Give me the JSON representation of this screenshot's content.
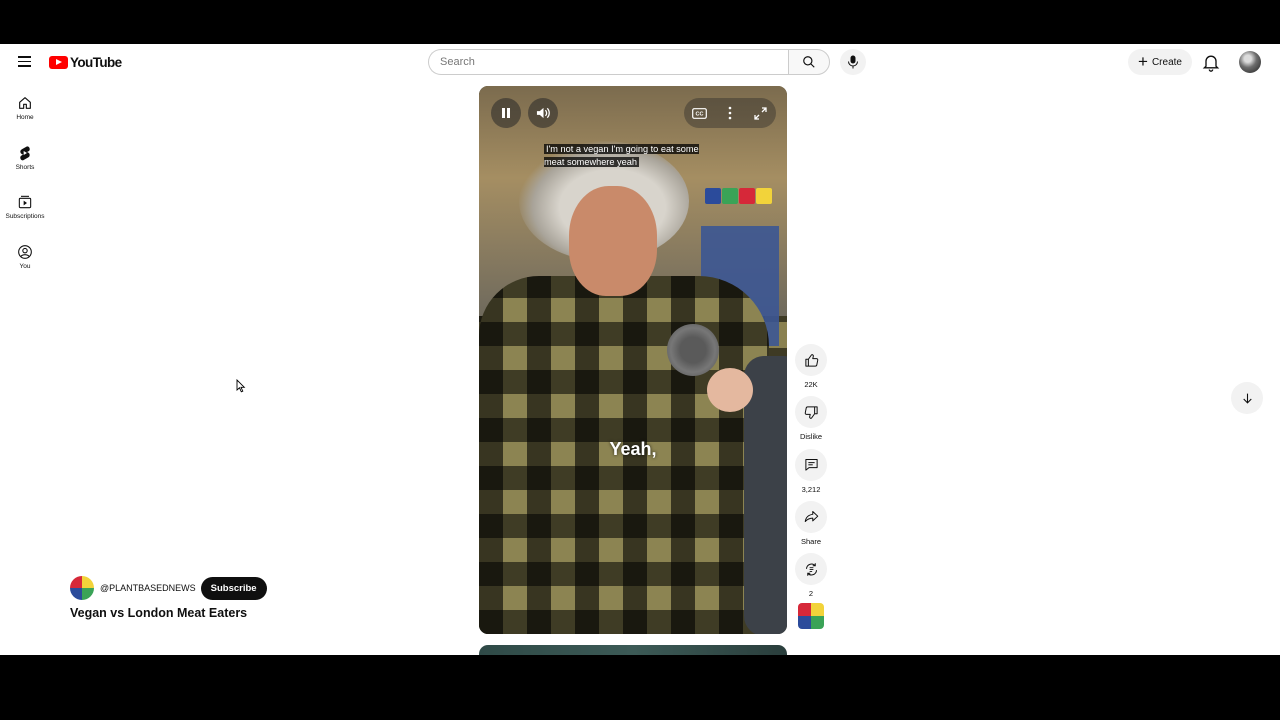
{
  "header": {
    "logo_text": "YouTube",
    "search_placeholder": "Search",
    "create_label": "Create"
  },
  "sidebar": {
    "items": [
      {
        "label": "Home",
        "icon": "home-icon"
      },
      {
        "label": "Shorts",
        "icon": "shorts-icon"
      },
      {
        "label": "Subscriptions",
        "icon": "subscriptions-icon"
      },
      {
        "label": "You",
        "icon": "you-icon"
      }
    ]
  },
  "video": {
    "caption": "I'm not a vegan I'm going to eat some meat somewhere yeah",
    "overlay_text": "Yeah,",
    "title": "Vegan vs London Meat Eaters",
    "channel_handle": "@PLANTBASEDNEWS",
    "subscribe_label": "Subscribe"
  },
  "actions": {
    "likes": "22K",
    "dislike": "Dislike",
    "comments": "3,212",
    "share": "Share",
    "remix": "2"
  },
  "colors": {
    "youtube_red": "#ff0000",
    "brand_blue": "#2b4b9b",
    "brand_green": "#3aa357",
    "brand_red": "#d62839",
    "brand_yellow": "#f2d33a"
  }
}
